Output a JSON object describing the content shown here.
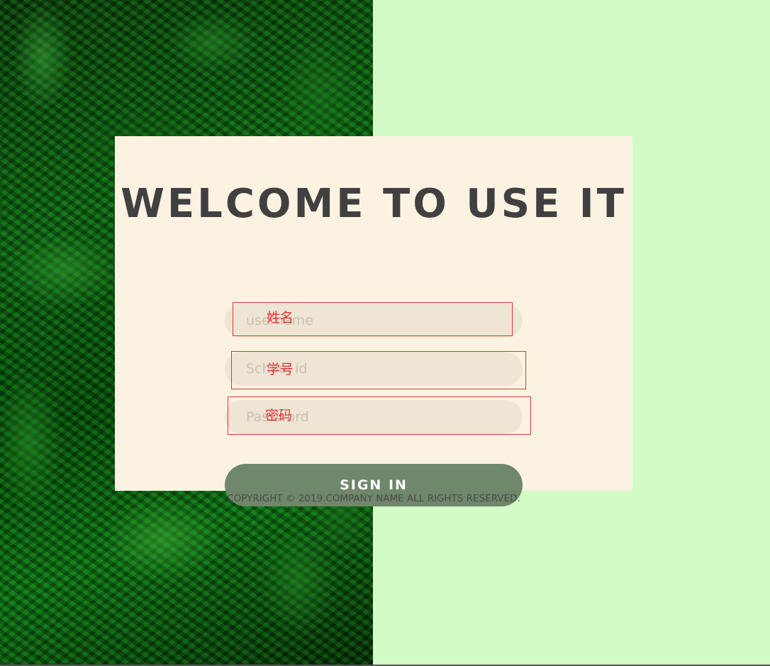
{
  "page": {
    "title_line": "WELCOME TO USE IT",
    "form": {
      "username": {
        "placeholder": "username",
        "annotation": "姓名"
      },
      "school_id": {
        "placeholder": "School id",
        "annotation": "学号"
      },
      "password": {
        "placeholder": "Password",
        "annotation": "密码"
      },
      "submit_label": "SIGN IN"
    },
    "copyright": "COPYRIGHT © 2019.COMPANY NAME ALL RIGHTS RESERVED."
  },
  "colors": {
    "right_panel": "#d3fbc6",
    "card": "#fbf2e2",
    "input_fill": "#efe5d4",
    "button": "#6f876a",
    "annotation": "#e03434",
    "title": "#404040"
  }
}
